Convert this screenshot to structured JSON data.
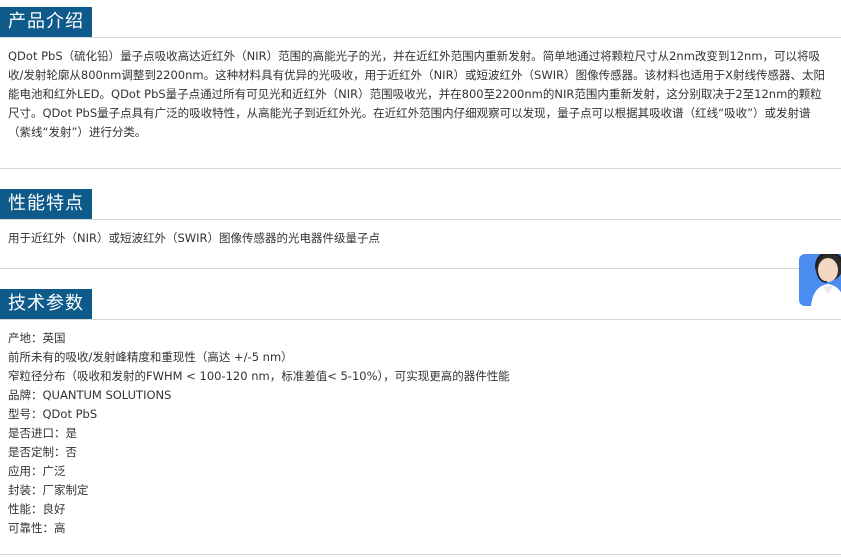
{
  "sections": {
    "intro": {
      "title": "产品介绍",
      "body": "QDot PbS（硫化铅）量子点吸收高达近红外（NIR）范围的高能光子的光，并在近红外范围内重新发射。简单地通过将颗粒尺寸从2nm改变到12nm，可以将吸收/发射轮廓从800nm调整到2200nm。这种材料具有优异的光吸收，用于近红外（NIR）或短波红外（SWIR）图像传感器。该材料也适用于X射线传感器、太阳能电池和红外LED。QDot PbS量子点通过所有可见光和近红外（NIR）范围吸收光，并在800至2200nm的NIR范围内重新发射，这分别取决于2至12nm的颗粒尺寸。QDot PbS量子点具有广泛的吸收特性，从高能光子到近红外光。在近红外范围内仔细观察可以发现，量子点可以根据其吸收谱（红线“吸收”）或发射谱（紫线“发射”）进行分类。"
    },
    "features": {
      "title": "性能特点",
      "body": "用于近红外（NIR）或短波红外（SWIR）图像传感器的光电器件级量子点"
    },
    "specs": {
      "title": "技术参数",
      "lines": [
        "产地：英国",
        "前所未有的吸收/发射峰精度和重现性（高达 +/-5 nm）",
        "窄粒径分布（吸收和发射的FWHM < 100-120 nm，标准差值< 5-10%），可实现更高的器件性能",
        "品牌：QUANTUM SOLUTIONS",
        "型号：QDot PbS",
        "是否进口：是",
        "是否定制：否",
        "应用：广泛",
        "封装：厂家制定",
        "性能：良好",
        "可靠性：高"
      ]
    }
  },
  "chat_widget": {
    "icon": "customer-service-avatar-icon",
    "bg_color": "#4a8cf0"
  },
  "colors": {
    "header_bg": "#0e5a8a",
    "text": "#333333",
    "divider": "#d8d8d8"
  }
}
